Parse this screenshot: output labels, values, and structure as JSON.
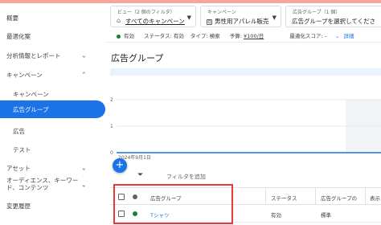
{
  "sidebar": {
    "items": [
      {
        "label": "概要"
      },
      {
        "label": "最適化案"
      },
      {
        "label": "分析情報とレポート",
        "chevron": "⌄"
      },
      {
        "label": "キャンペーン",
        "chevron": "⌃"
      },
      {
        "label": "キャンペーン"
      },
      {
        "label": "広告グループ"
      },
      {
        "label": "広告"
      },
      {
        "label": "テスト"
      },
      {
        "label": "アセット",
        "chevron": "⌄"
      },
      {
        "label": "オーディエンス、キーワード、コンテンツ",
        "chevron": "⌄"
      },
      {
        "label": "変更履歴"
      }
    ]
  },
  "header": {
    "view_caption": "ビュー（2 個のフィルタ）",
    "view_value": "すべてのキャンペーン",
    "campaign_caption": "キャンペーン",
    "campaign_value": "男性用アパレル販売",
    "adgroup_caption": "広告グループ（1 個）",
    "adgroup_value": "広告グループを選択してくださ"
  },
  "info_bar": {
    "status_active": "有効",
    "status_text": "ステータス: 有効",
    "type_text": "タイプ: 検索",
    "budget_label": "予算: ",
    "budget_value": "¥100/日",
    "opt_score": "最適化スコア: –",
    "detail_label": "詳細"
  },
  "page_title": "広告グループ",
  "chart_data": {
    "type": "line",
    "yticks": [
      "2",
      "1",
      "0"
    ],
    "ylim": [
      0,
      2
    ],
    "x_start_label": "2024年9月1日",
    "series": [
      {
        "values": [
          0,
          0
        ]
      }
    ]
  },
  "filter": {
    "label": "フィルタを追加"
  },
  "table": {
    "headers": [
      "広告グループ",
      "ステータス",
      "広告グループの",
      "表示"
    ],
    "rows": [
      {
        "name": "Tシャツ",
        "status": "有効",
        "type": "標準",
        "extra": ""
      }
    ]
  },
  "colors": {
    "accent": "#1a73e8",
    "active_status": "#188038",
    "highlight_box": "#e53935"
  }
}
